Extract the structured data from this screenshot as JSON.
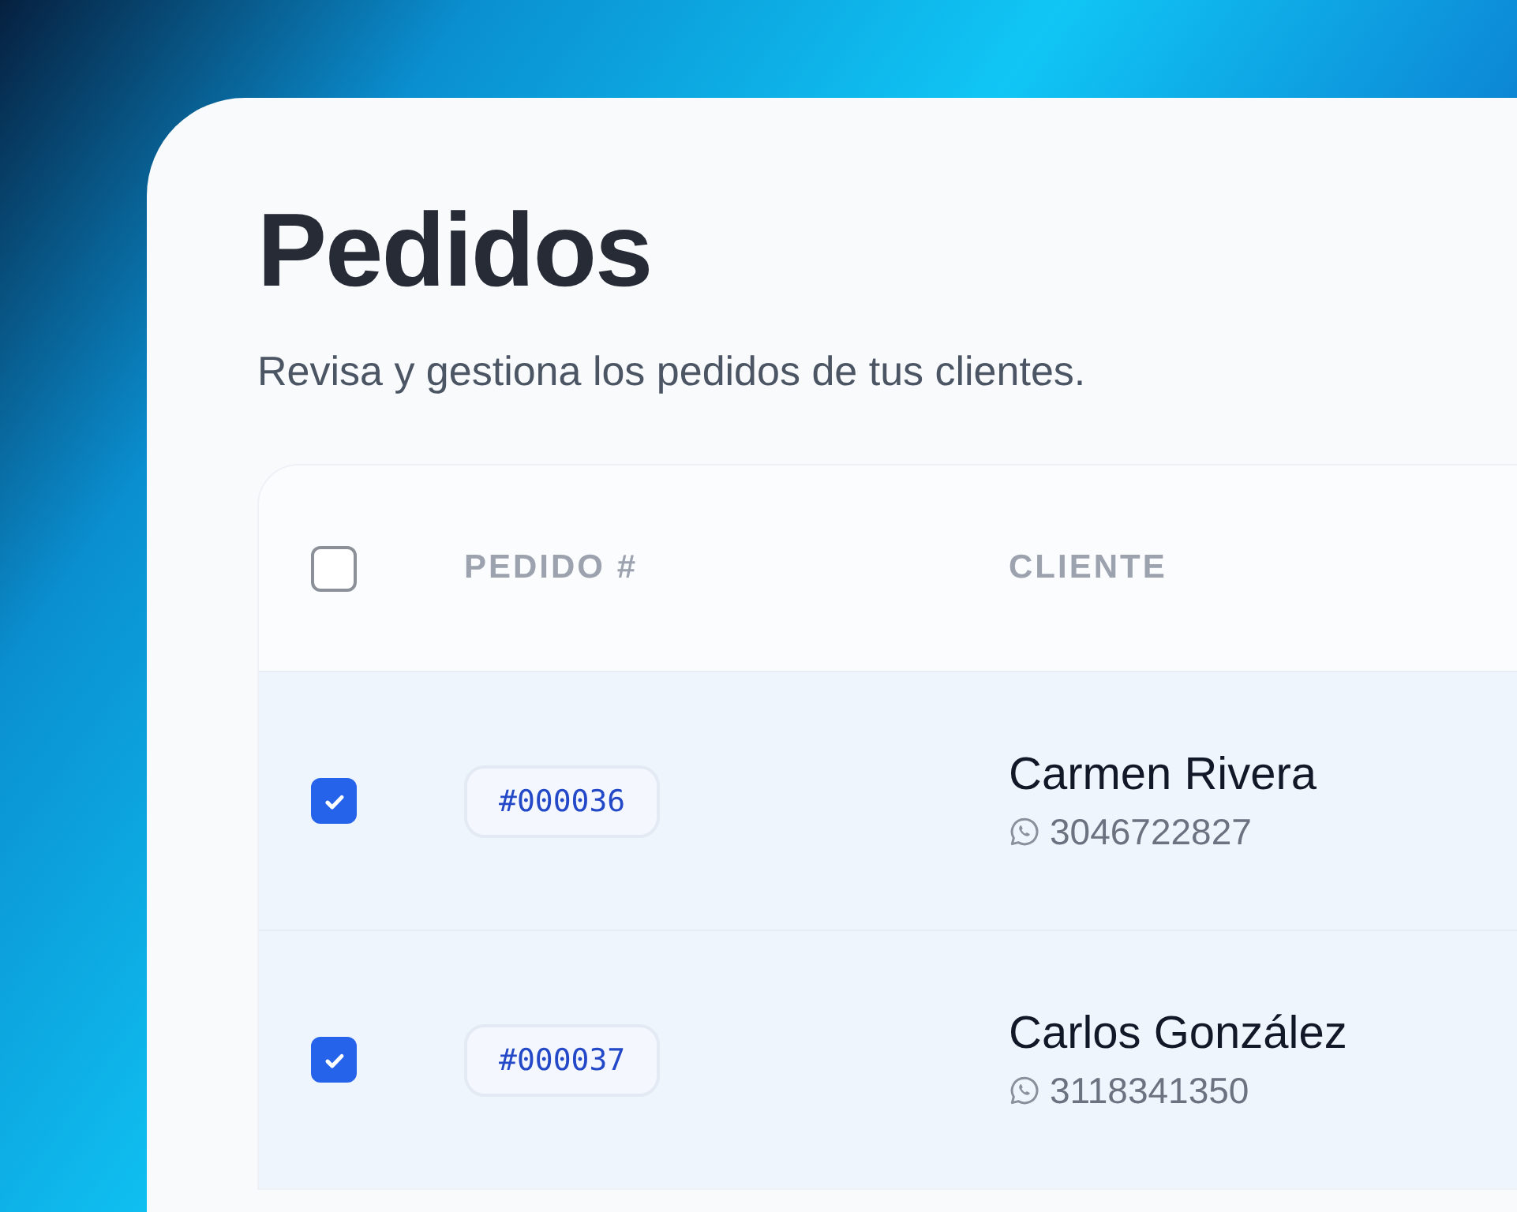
{
  "page": {
    "title": "Pedidos",
    "subtitle": "Revisa y gestiona los pedidos de tus clientes."
  },
  "table": {
    "select_all": {
      "checked": false
    },
    "columns": [
      "PEDIDO #",
      "CLIENTE"
    ],
    "rows": [
      {
        "selected": true,
        "order": "#000036",
        "customer": "Carmen Rivera",
        "phone": "3046722827"
      },
      {
        "selected": true,
        "order": "#000037",
        "customer": "Carlos González",
        "phone": "3118341350"
      }
    ]
  }
}
